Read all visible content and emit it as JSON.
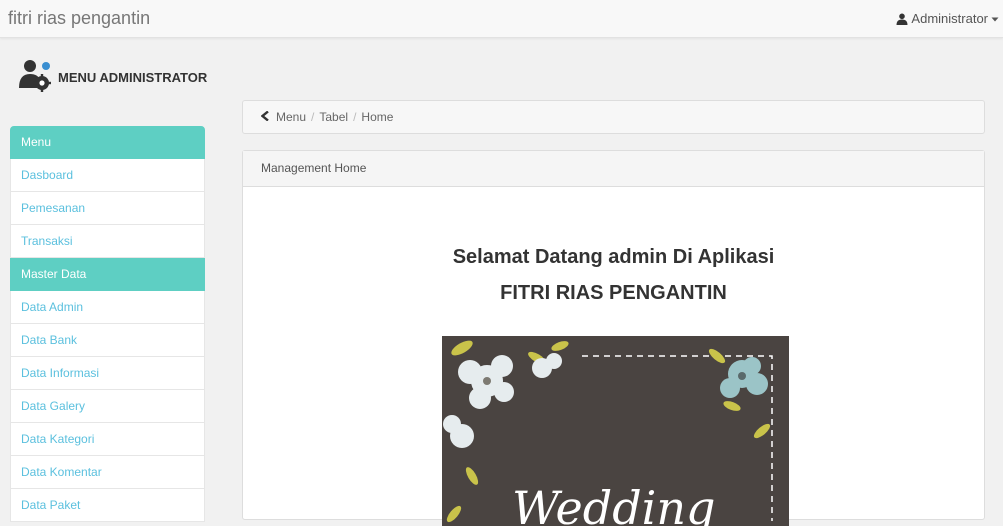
{
  "navbar": {
    "brand": "fitri rias pengantin",
    "user_label": "Administrator"
  },
  "sidebar": {
    "title": "MENU ADMINISTRATOR",
    "items": [
      {
        "label": "Menu",
        "active": true
      },
      {
        "label": "Dasboard",
        "active": false
      },
      {
        "label": "Pemesanan",
        "active": false
      },
      {
        "label": "Transaksi",
        "active": false
      },
      {
        "label": "Master Data",
        "active": true
      },
      {
        "label": "Data Admin",
        "active": false
      },
      {
        "label": "Data Bank",
        "active": false
      },
      {
        "label": "Data Informasi",
        "active": false
      },
      {
        "label": "Data Galery",
        "active": false
      },
      {
        "label": "Data Kategori",
        "active": false
      },
      {
        "label": "Data Komentar",
        "active": false
      },
      {
        "label": "Data Paket",
        "active": false
      }
    ]
  },
  "breadcrumb": [
    "Menu",
    "Tabel",
    "Home"
  ],
  "panel": {
    "heading": "Management Home",
    "welcome_line1": "Selamat Datang admin Di Aplikasi",
    "welcome_line2": "FITRI RIAS PENGANTIN",
    "image_text": "Wedding"
  },
  "colors": {
    "accent": "#5ecfc3",
    "link": "#5bc0de",
    "image_bg": "#4a4441"
  }
}
